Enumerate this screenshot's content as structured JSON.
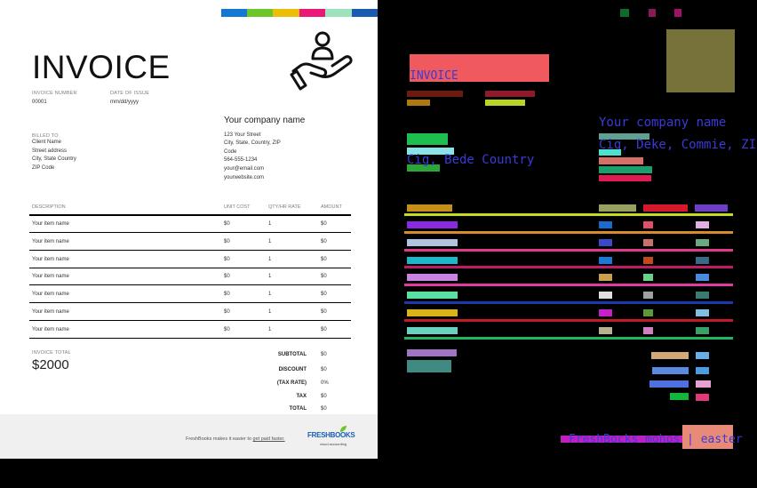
{
  "colors": {
    "stripe": [
      "#1278d1",
      "#6cc62a",
      "#ecbe08",
      "#ea1678",
      "#9ee3be",
      "#1a5ab0"
    ],
    "ink": "#111111",
    "label_gray": "#7d7d7d",
    "footer_bg": "#f0f0f0",
    "brand_blue": "#1a5fb4"
  },
  "invoice": {
    "title": "INVOICE",
    "invoice_number_label": "INVOICE NUMBER",
    "invoice_number": "00001",
    "date_label": "DATE OF ISSUE",
    "date": "mm/dd/yyyy",
    "billed_to_label": "BILLED TO",
    "billed_to": [
      "Client Name",
      "Street address",
      "City, State Country",
      "ZIP Code"
    ],
    "company": {
      "name": "Your company name",
      "lines": [
        "123 Your Street",
        "City, State, Country, ZIP",
        "Code",
        "564-555-1234",
        "your@email.com",
        "yourwebsite.com"
      ]
    },
    "columns": [
      "DESCRIPTION",
      "UNIT COST",
      "QTY/HR RATE",
      "AMOUNT"
    ],
    "items": [
      {
        "description": "Your item name",
        "unit_cost": "$0",
        "qty": "1",
        "amount": "$0"
      },
      {
        "description": "Your item name",
        "unit_cost": "$0",
        "qty": "1",
        "amount": "$0"
      },
      {
        "description": "Your item name",
        "unit_cost": "$0",
        "qty": "1",
        "amount": "$0"
      },
      {
        "description": "Your item name",
        "unit_cost": "$0",
        "qty": "1",
        "amount": "$0"
      },
      {
        "description": "Your item name",
        "unit_cost": "$0",
        "qty": "1",
        "amount": "$0"
      },
      {
        "description": "Your item name",
        "unit_cost": "$0",
        "qty": "1",
        "amount": "$0"
      },
      {
        "description": "Your item name",
        "unit_cost": "$0",
        "qty": "1",
        "amount": "$0"
      }
    ],
    "invoice_total_label": "INVOICE TOTAL",
    "invoice_total": "$2000",
    "totals": [
      {
        "label": "SUBTOTAL",
        "value": "$0"
      },
      {
        "label": "DISCOUNT",
        "value": "$0"
      },
      {
        "label": "(TAX RATE)",
        "value": "0%"
      },
      {
        "label": "TAX",
        "value": "$0"
      },
      {
        "label": "TOTAL",
        "value": "$0"
      }
    ],
    "footer": {
      "text": "FreshBooks makes it easier to",
      "link": "get paid faster.",
      "logo": "FRESHBOOKS",
      "logo_sub": "cloud accounting"
    }
  },
  "layout_map": {
    "title_text": "INVOICE",
    "company_text": "Your company name",
    "city_text": "Cig, Deke, Commie, ZIP",
    "bill_text": "Cig, Bede Country",
    "footer_text": "FreshBocks mohos | easter"
  }
}
